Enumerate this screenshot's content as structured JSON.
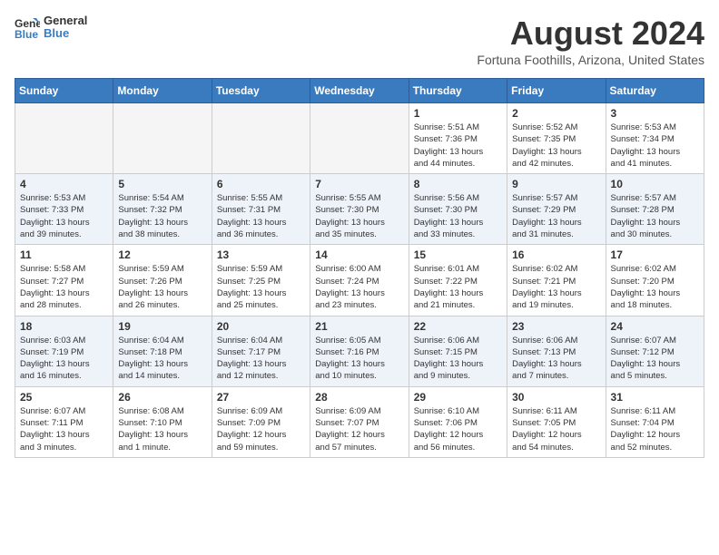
{
  "logo": {
    "line1": "General",
    "line2": "Blue"
  },
  "title": "August 2024",
  "location": "Fortuna Foothills, Arizona, United States",
  "weekdays": [
    "Sunday",
    "Monday",
    "Tuesday",
    "Wednesday",
    "Thursday",
    "Friday",
    "Saturday"
  ],
  "weeks": [
    [
      {
        "day": "",
        "info": ""
      },
      {
        "day": "",
        "info": ""
      },
      {
        "day": "",
        "info": ""
      },
      {
        "day": "",
        "info": ""
      },
      {
        "day": "1",
        "info": "Sunrise: 5:51 AM\nSunset: 7:36 PM\nDaylight: 13 hours\nand 44 minutes."
      },
      {
        "day": "2",
        "info": "Sunrise: 5:52 AM\nSunset: 7:35 PM\nDaylight: 13 hours\nand 42 minutes."
      },
      {
        "day": "3",
        "info": "Sunrise: 5:53 AM\nSunset: 7:34 PM\nDaylight: 13 hours\nand 41 minutes."
      }
    ],
    [
      {
        "day": "4",
        "info": "Sunrise: 5:53 AM\nSunset: 7:33 PM\nDaylight: 13 hours\nand 39 minutes."
      },
      {
        "day": "5",
        "info": "Sunrise: 5:54 AM\nSunset: 7:32 PM\nDaylight: 13 hours\nand 38 minutes."
      },
      {
        "day": "6",
        "info": "Sunrise: 5:55 AM\nSunset: 7:31 PM\nDaylight: 13 hours\nand 36 minutes."
      },
      {
        "day": "7",
        "info": "Sunrise: 5:55 AM\nSunset: 7:30 PM\nDaylight: 13 hours\nand 35 minutes."
      },
      {
        "day": "8",
        "info": "Sunrise: 5:56 AM\nSunset: 7:30 PM\nDaylight: 13 hours\nand 33 minutes."
      },
      {
        "day": "9",
        "info": "Sunrise: 5:57 AM\nSunset: 7:29 PM\nDaylight: 13 hours\nand 31 minutes."
      },
      {
        "day": "10",
        "info": "Sunrise: 5:57 AM\nSunset: 7:28 PM\nDaylight: 13 hours\nand 30 minutes."
      }
    ],
    [
      {
        "day": "11",
        "info": "Sunrise: 5:58 AM\nSunset: 7:27 PM\nDaylight: 13 hours\nand 28 minutes."
      },
      {
        "day": "12",
        "info": "Sunrise: 5:59 AM\nSunset: 7:26 PM\nDaylight: 13 hours\nand 26 minutes."
      },
      {
        "day": "13",
        "info": "Sunrise: 5:59 AM\nSunset: 7:25 PM\nDaylight: 13 hours\nand 25 minutes."
      },
      {
        "day": "14",
        "info": "Sunrise: 6:00 AM\nSunset: 7:24 PM\nDaylight: 13 hours\nand 23 minutes."
      },
      {
        "day": "15",
        "info": "Sunrise: 6:01 AM\nSunset: 7:22 PM\nDaylight: 13 hours\nand 21 minutes."
      },
      {
        "day": "16",
        "info": "Sunrise: 6:02 AM\nSunset: 7:21 PM\nDaylight: 13 hours\nand 19 minutes."
      },
      {
        "day": "17",
        "info": "Sunrise: 6:02 AM\nSunset: 7:20 PM\nDaylight: 13 hours\nand 18 minutes."
      }
    ],
    [
      {
        "day": "18",
        "info": "Sunrise: 6:03 AM\nSunset: 7:19 PM\nDaylight: 13 hours\nand 16 minutes."
      },
      {
        "day": "19",
        "info": "Sunrise: 6:04 AM\nSunset: 7:18 PM\nDaylight: 13 hours\nand 14 minutes."
      },
      {
        "day": "20",
        "info": "Sunrise: 6:04 AM\nSunset: 7:17 PM\nDaylight: 13 hours\nand 12 minutes."
      },
      {
        "day": "21",
        "info": "Sunrise: 6:05 AM\nSunset: 7:16 PM\nDaylight: 13 hours\nand 10 minutes."
      },
      {
        "day": "22",
        "info": "Sunrise: 6:06 AM\nSunset: 7:15 PM\nDaylight: 13 hours\nand 9 minutes."
      },
      {
        "day": "23",
        "info": "Sunrise: 6:06 AM\nSunset: 7:13 PM\nDaylight: 13 hours\nand 7 minutes."
      },
      {
        "day": "24",
        "info": "Sunrise: 6:07 AM\nSunset: 7:12 PM\nDaylight: 13 hours\nand 5 minutes."
      }
    ],
    [
      {
        "day": "25",
        "info": "Sunrise: 6:07 AM\nSunset: 7:11 PM\nDaylight: 13 hours\nand 3 minutes."
      },
      {
        "day": "26",
        "info": "Sunrise: 6:08 AM\nSunset: 7:10 PM\nDaylight: 13 hours\nand 1 minute."
      },
      {
        "day": "27",
        "info": "Sunrise: 6:09 AM\nSunset: 7:09 PM\nDaylight: 12 hours\nand 59 minutes."
      },
      {
        "day": "28",
        "info": "Sunrise: 6:09 AM\nSunset: 7:07 PM\nDaylight: 12 hours\nand 57 minutes."
      },
      {
        "day": "29",
        "info": "Sunrise: 6:10 AM\nSunset: 7:06 PM\nDaylight: 12 hours\nand 56 minutes."
      },
      {
        "day": "30",
        "info": "Sunrise: 6:11 AM\nSunset: 7:05 PM\nDaylight: 12 hours\nand 54 minutes."
      },
      {
        "day": "31",
        "info": "Sunrise: 6:11 AM\nSunset: 7:04 PM\nDaylight: 12 hours\nand 52 minutes."
      }
    ]
  ]
}
